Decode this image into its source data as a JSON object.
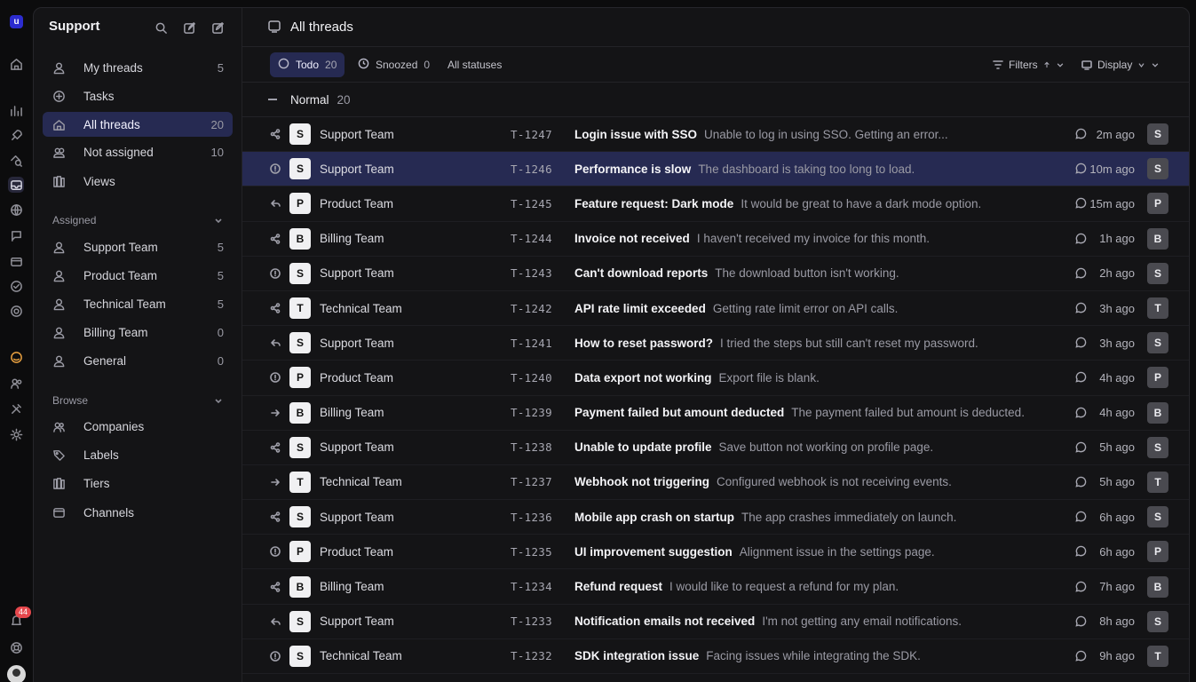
{
  "rail": {
    "logo": "u",
    "notification_count": "44"
  },
  "sidebar": {
    "title": "Support",
    "nav": [
      {
        "label": "My threads",
        "count": "5",
        "icon": "user-icon"
      },
      {
        "label": "Tasks",
        "count": "",
        "icon": "tasks-icon"
      },
      {
        "label": "All threads",
        "count": "20",
        "icon": "threads-icon",
        "active": true
      },
      {
        "label": "Not assigned",
        "count": "10",
        "icon": "inbox-icon"
      },
      {
        "label": "Views",
        "count": "",
        "icon": "views-icon"
      }
    ],
    "assigned_label": "Assigned",
    "assigned": [
      {
        "label": "Support Team",
        "count": "5"
      },
      {
        "label": "Product Team",
        "count": "5"
      },
      {
        "label": "Technical Team",
        "count": "5"
      },
      {
        "label": "Billing Team",
        "count": "0"
      },
      {
        "label": "General",
        "count": "0"
      }
    ],
    "browse_label": "Browse",
    "browse": [
      {
        "label": "Companies",
        "icon": "companies-icon"
      },
      {
        "label": "Labels",
        "icon": "label-icon"
      },
      {
        "label": "Tiers",
        "icon": "tiers-icon"
      },
      {
        "label": "Channels",
        "icon": "channels-icon"
      }
    ]
  },
  "main": {
    "title": "All threads",
    "filters": {
      "todo_label": "Todo",
      "todo_count": "20",
      "snoozed_label": "Snoozed",
      "snoozed_count": "0",
      "all_statuses": "All statuses",
      "filters_label": "Filters",
      "display_label": "Display"
    },
    "group": {
      "label": "Normal",
      "count": "20"
    },
    "rows": [
      {
        "status": "share",
        "team_initial": "S",
        "team": "Support Team",
        "id": "T-1247",
        "subject": "Login issue with SSO",
        "preview": "Unable to log in using SSO. Getting an error...",
        "time": "2m ago",
        "assignee": "S"
      },
      {
        "status": "alert",
        "team_initial": "S",
        "team": "Support Team",
        "id": "T-1246",
        "subject": "Performance is slow",
        "preview": "The dashboard is taking too long to load.",
        "time": "10m ago",
        "assignee": "S",
        "selected": true
      },
      {
        "status": "reply",
        "team_initial": "P",
        "team": "Product Team",
        "id": "T-1245",
        "subject": "Feature request: Dark mode",
        "preview": "It would be great to have a dark mode option.",
        "time": "15m ago",
        "assignee": "P"
      },
      {
        "status": "share",
        "team_initial": "B",
        "team": "Billing Team",
        "id": "T-1244",
        "subject": "Invoice not received",
        "preview": "I haven't received my invoice for this month.",
        "time": "1h ago",
        "assignee": "B"
      },
      {
        "status": "alert",
        "team_initial": "S",
        "team": "Support Team",
        "id": "T-1243",
        "subject": "Can't download reports",
        "preview": "The download button isn't working.",
        "time": "2h ago",
        "assignee": "S"
      },
      {
        "status": "share",
        "team_initial": "T",
        "team": "Technical Team",
        "id": "T-1242",
        "subject": "API rate limit exceeded",
        "preview": "Getting rate limit error on API calls.",
        "time": "3h ago",
        "assignee": "T"
      },
      {
        "status": "reply",
        "team_initial": "S",
        "team": "Support Team",
        "id": "T-1241",
        "subject": "How to reset password?",
        "preview": "I tried the steps but still can't reset my password.",
        "time": "3h ago",
        "assignee": "S"
      },
      {
        "status": "alert",
        "team_initial": "P",
        "team": "Product Team",
        "id": "T-1240",
        "subject": "Data export not working",
        "preview": "Export file is blank.",
        "time": "4h ago",
        "assignee": "P"
      },
      {
        "status": "arrow",
        "team_initial": "B",
        "team": "Billing Team",
        "id": "T-1239",
        "subject": "Payment failed but amount deducted",
        "preview": "The payment failed but amount is deducted.",
        "time": "4h ago",
        "assignee": "B"
      },
      {
        "status": "share",
        "team_initial": "S",
        "team": "Support Team",
        "id": "T-1238",
        "subject": "Unable to update profile",
        "preview": "Save button not working on profile page.",
        "time": "5h ago",
        "assignee": "S"
      },
      {
        "status": "arrow",
        "team_initial": "T",
        "team": "Technical Team",
        "id": "T-1237",
        "subject": "Webhook not triggering",
        "preview": "Configured webhook is not receiving events.",
        "time": "5h ago",
        "assignee": "T"
      },
      {
        "status": "share",
        "team_initial": "S",
        "team": "Support Team",
        "id": "T-1236",
        "subject": "Mobile app crash on startup",
        "preview": "The app crashes immediately on launch.",
        "time": "6h ago",
        "assignee": "S"
      },
      {
        "status": "alert",
        "team_initial": "P",
        "team": "Product Team",
        "id": "T-1235",
        "subject": "UI improvement suggestion",
        "preview": "Alignment issue in the settings page.",
        "time": "6h ago",
        "assignee": "P"
      },
      {
        "status": "share",
        "team_initial": "B",
        "team": "Billing Team",
        "id": "T-1234",
        "subject": "Refund request",
        "preview": "I would like to request a refund for my plan.",
        "time": "7h ago",
        "assignee": "B"
      },
      {
        "status": "reply",
        "team_initial": "S",
        "team": "Support Team",
        "id": "T-1233",
        "subject": "Notification emails not received",
        "preview": "I'm not getting any email notifications.",
        "time": "8h ago",
        "assignee": "S"
      },
      {
        "status": "alert",
        "team_initial": "S",
        "team": "Technical Team",
        "id": "T-1232",
        "subject": "SDK integration issue",
        "preview": "Facing issues while integrating the SDK.",
        "time": "9h ago",
        "assignee": "T"
      }
    ]
  }
}
